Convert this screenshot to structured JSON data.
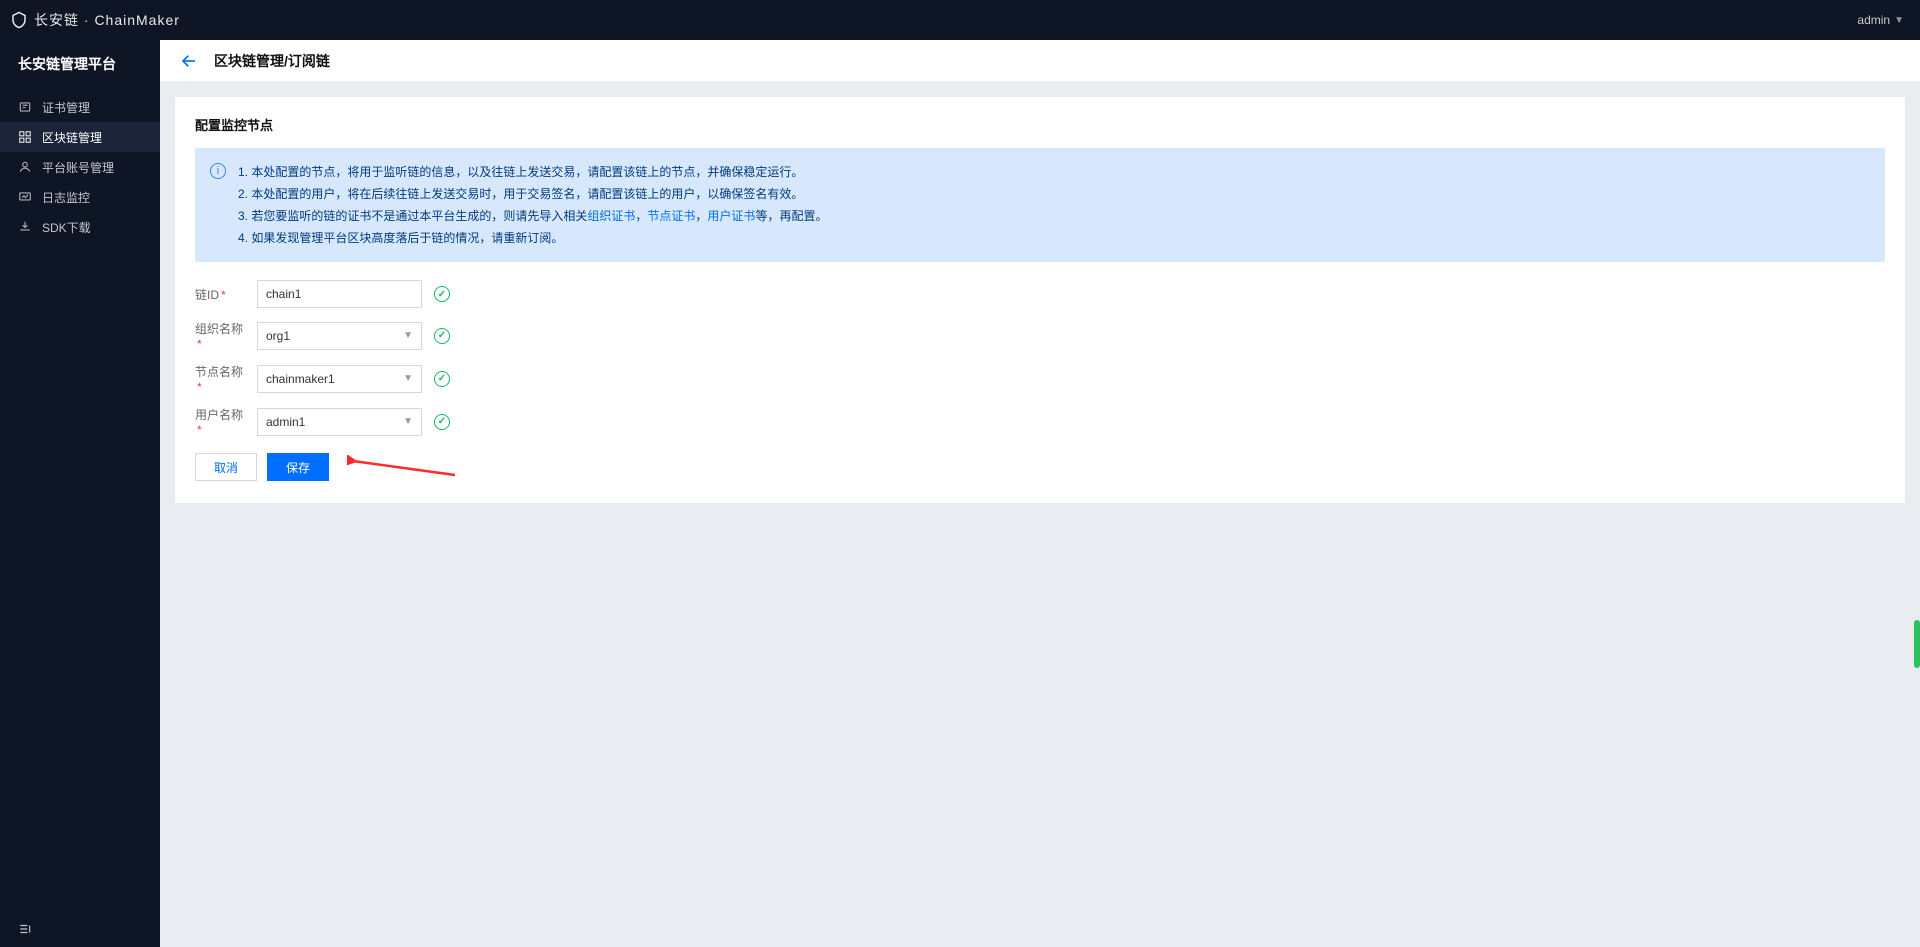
{
  "header": {
    "brand_text": "长安链 · ChainMaker",
    "user_label": "admin"
  },
  "sidebar": {
    "platform_title": "长安链管理平台",
    "items": [
      {
        "label": "证书管理",
        "icon": "cert-icon",
        "active": false
      },
      {
        "label": "区块链管理",
        "icon": "blockchain-icon",
        "active": true
      },
      {
        "label": "平台账号管理",
        "icon": "user-icon",
        "active": false
      },
      {
        "label": "日志监控",
        "icon": "monitor-icon",
        "active": false
      },
      {
        "label": "SDK下载",
        "icon": "download-icon",
        "active": false
      }
    ]
  },
  "page": {
    "breadcrumb": "区块链管理/订阅链",
    "card_title": "配置监控节点"
  },
  "alert": {
    "line1": "1. 本处配置的节点，将用于监听链的信息，以及往链上发送交易，请配置该链上的节点，并确保稳定运行。",
    "line2": "2. 本处配置的用户，将在后续往链上发送交易时，用于交易签名，请配置该链上的用户，以确保签名有效。",
    "line3_prefix": "3. 若您要监听的链的证书不是通过本平台生成的，则请先导入相关",
    "link_org": "组织证书",
    "sep": "，",
    "link_node": "节点证书",
    "link_user": "用户证书",
    "line3_suffix": "等，再配置。",
    "line4": "4. 如果发现管理平台区块高度落后于链的情况，请重新订阅。"
  },
  "form": {
    "chain_id": {
      "label": "链ID",
      "value": "chain1"
    },
    "org_name": {
      "label": "组织名称",
      "value": "org1"
    },
    "node_name": {
      "label": "节点名称",
      "value": "chainmaker1"
    },
    "user_name": {
      "label": "用户名称",
      "value": "admin1"
    }
  },
  "actions": {
    "cancel": "取消",
    "save": "保存"
  }
}
